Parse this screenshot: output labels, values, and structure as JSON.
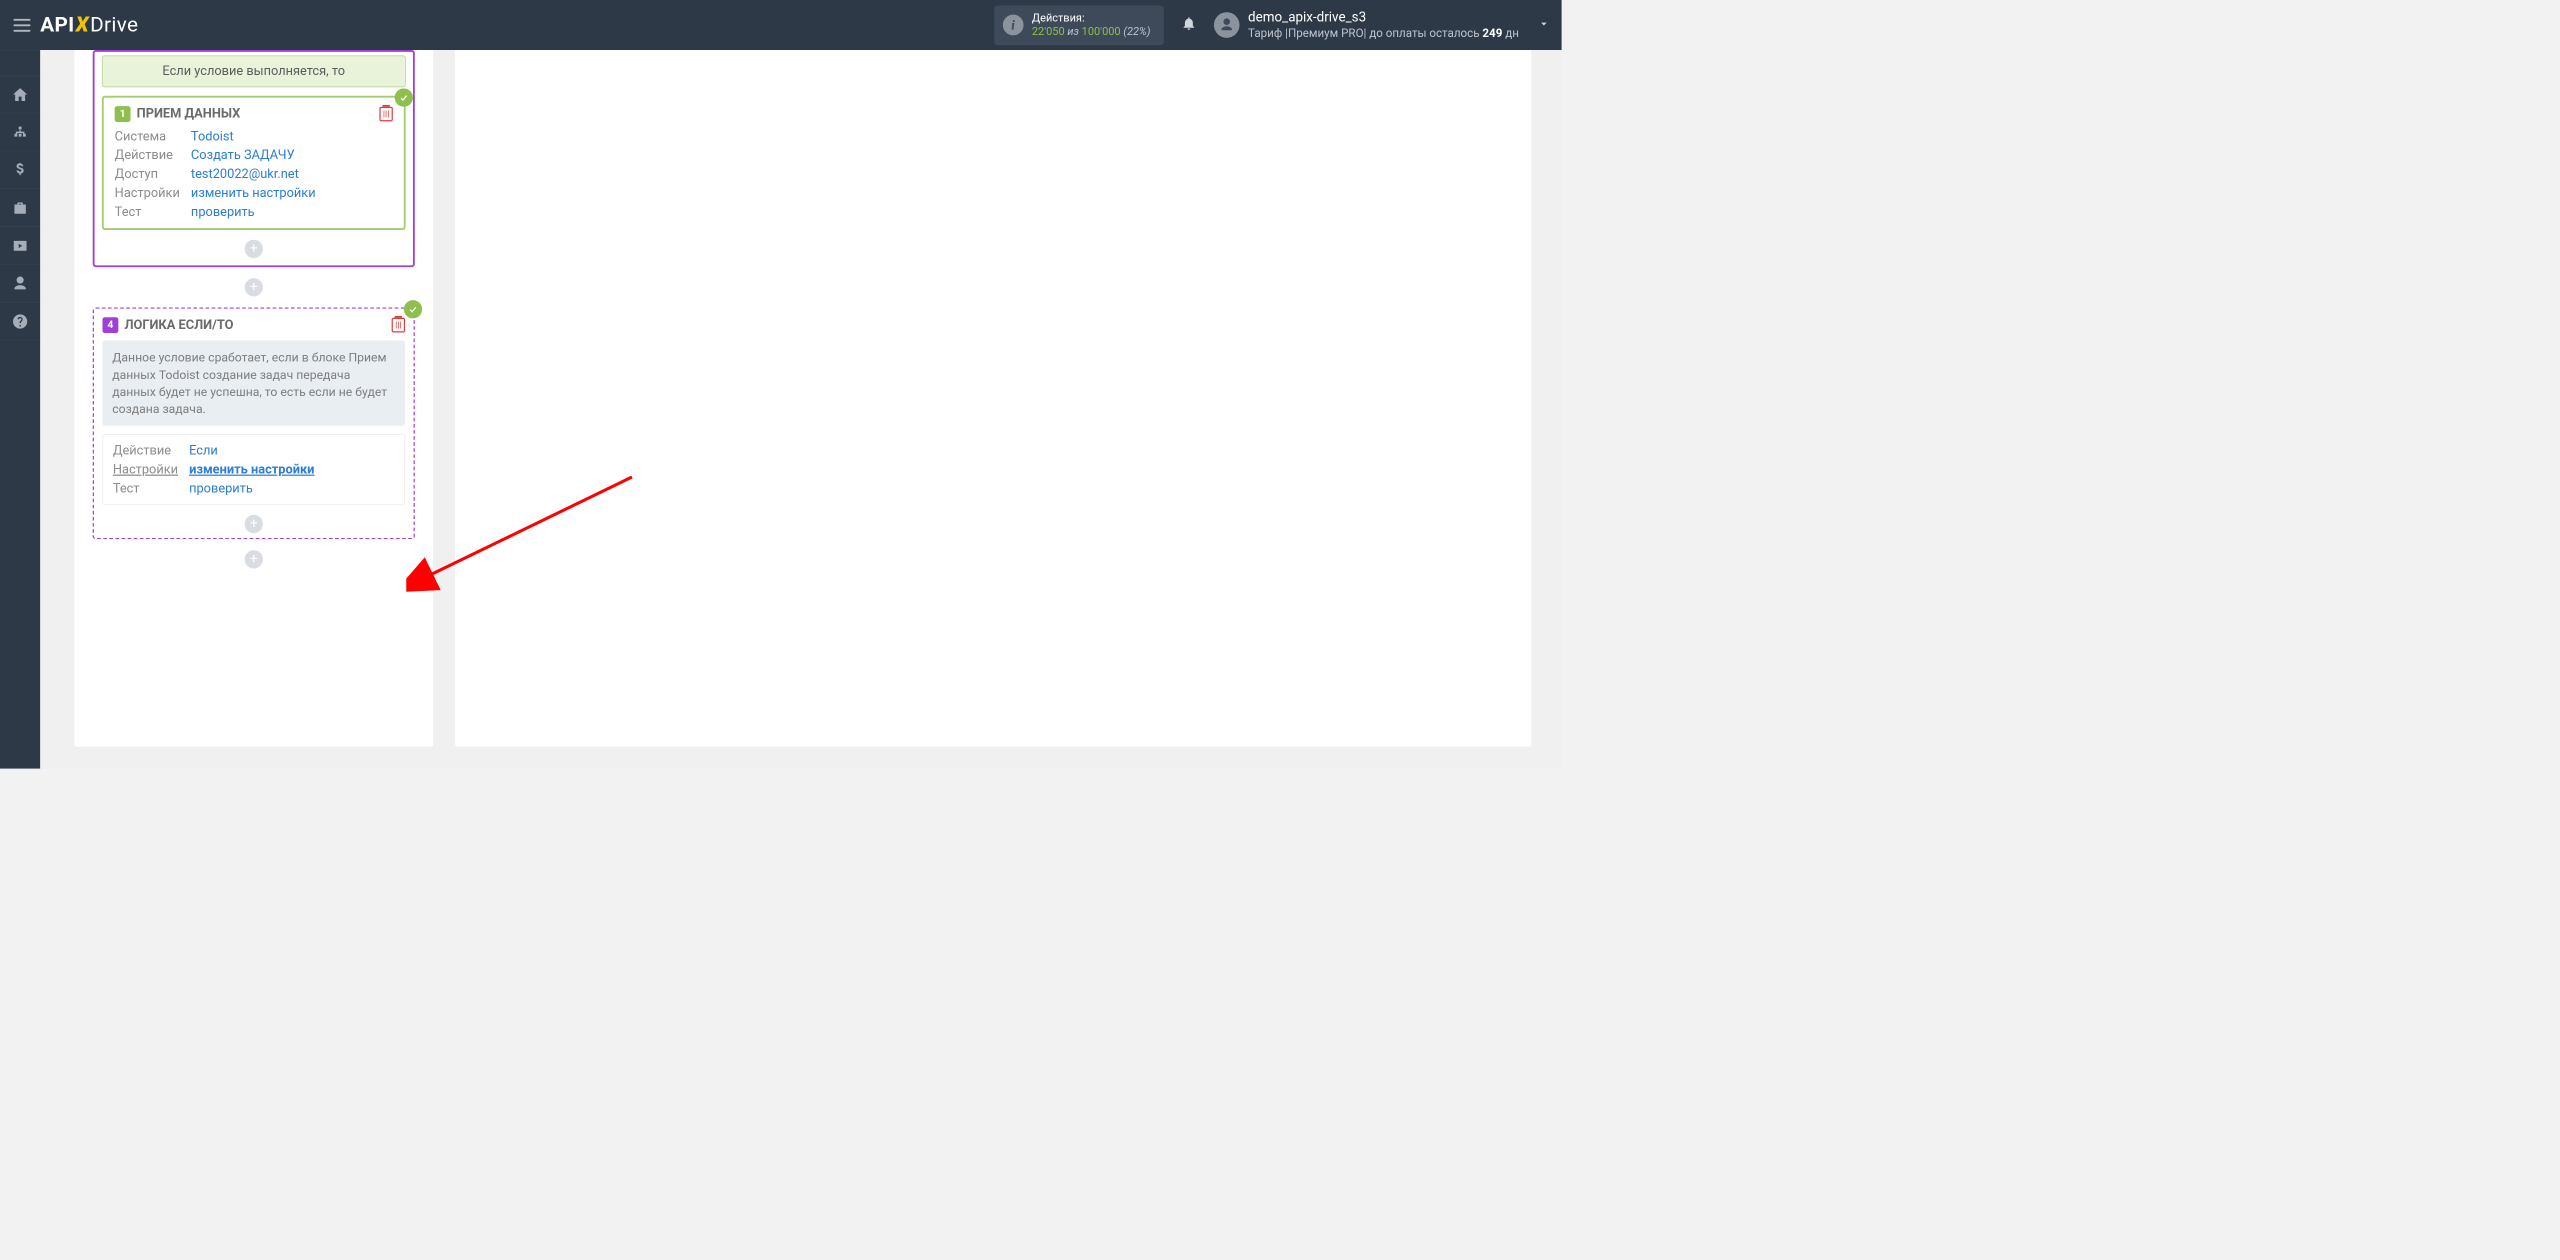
{
  "header": {
    "logo": {
      "api": "API",
      "x": "X",
      "drive": "Drive"
    },
    "actions": {
      "label": "Действия:",
      "used": "22'050",
      "of": "из",
      "total": "100'000",
      "pct": "(22%)"
    },
    "user": {
      "name": "demo_apix-drive_s3",
      "tariff_prefix": "Тариф |",
      "tariff": "Премиум PRO",
      "pay_prefix": "| до оплаты осталось ",
      "days": "249",
      "days_suffix": " дн"
    }
  },
  "block1": {
    "cond": "Если условие выполняется, то",
    "badge": "1",
    "title": "ПРИЕМ ДАННЫХ",
    "rows": {
      "system_lbl": "Система",
      "system_val": "Todoist",
      "action_lbl": "Действие",
      "action_val": "Создать ЗАДАЧУ",
      "access_lbl": "Доступ",
      "access_val": "test20022@ukr.net",
      "settings_lbl": "Настройки",
      "settings_val": "изменить настройки",
      "test_lbl": "Тест",
      "test_val": "проверить"
    }
  },
  "block2": {
    "badge": "4",
    "title": "ЛОГИКА ЕСЛИ/ТО",
    "info": "Данное условие сработает, если в блоке Прием данных Todoist создание задач передача данных будет не успешна, то есть если не будет создана задача.",
    "rows": {
      "action_lbl": "Действие",
      "action_val": "Если",
      "settings_lbl": "Настройки",
      "settings_val": "изменить настройки",
      "test_lbl": "Тест",
      "test_val": "проверить"
    }
  }
}
